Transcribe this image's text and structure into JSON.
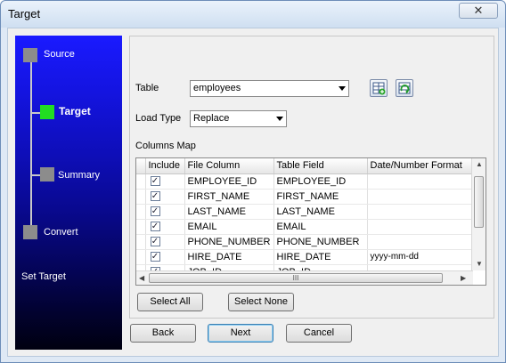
{
  "window": {
    "title": "Target",
    "close_label": "✕"
  },
  "steps": {
    "items": [
      {
        "label": "Source"
      },
      {
        "label": "Target"
      },
      {
        "label": "Summary"
      },
      {
        "label": "Convert"
      }
    ],
    "current_title": "Set Target"
  },
  "form": {
    "table_label": "Table",
    "table_value": "employees",
    "load_type_label": "Load Type",
    "load_type_value": "Replace",
    "columns_map_label": "Columns Map"
  },
  "grid": {
    "headers": [
      "Include",
      "File Column",
      "Table Field",
      "Date/Number Format"
    ],
    "rows": [
      {
        "include": "✓",
        "file": "EMPLOYEE_ID",
        "field": "EMPLOYEE_ID",
        "format": ""
      },
      {
        "include": "✓",
        "file": "FIRST_NAME",
        "field": "FIRST_NAME",
        "format": ""
      },
      {
        "include": "✓",
        "file": "LAST_NAME",
        "field": "LAST_NAME",
        "format": ""
      },
      {
        "include": "✓",
        "file": "EMAIL",
        "field": "EMAIL",
        "format": ""
      },
      {
        "include": "✓",
        "file": "PHONE_NUMBER",
        "field": "PHONE_NUMBER",
        "format": ""
      },
      {
        "include": "✓",
        "file": "HIRE_DATE",
        "field": "HIRE_DATE",
        "format": "yyyy-mm-dd"
      },
      {
        "include": "✓",
        "file": "JOB_ID",
        "field": "JOB_ID",
        "format": ""
      }
    ],
    "hscroll_grip": "III"
  },
  "buttons": {
    "select_all": "Select All",
    "select_none": "Select None",
    "back": "Back",
    "next": "Next",
    "cancel": "Cancel"
  },
  "colors": {
    "active_step": "#22dd22",
    "panel_top": "#1a1aff",
    "panel_bottom": "#000010"
  }
}
